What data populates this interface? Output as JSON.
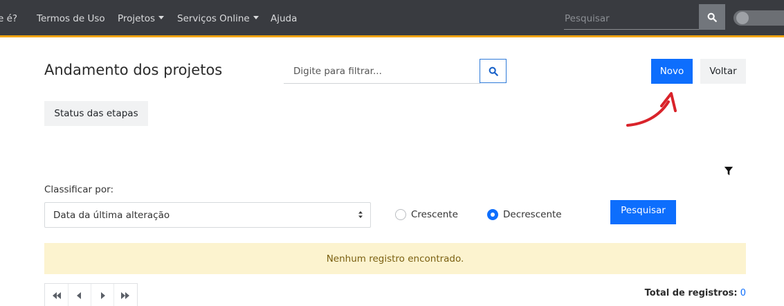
{
  "nav": {
    "items": [
      {
        "label": "e é?"
      },
      {
        "label": "Termos de Uso"
      },
      {
        "label": "Projetos"
      },
      {
        "label": "Serviços Online"
      },
      {
        "label": "Ajuda"
      }
    ],
    "search_placeholder": "Pesquisar"
  },
  "header": {
    "title": "Andamento dos projetos",
    "filter_placeholder": "Digite para filtrar...",
    "new_label": "Novo",
    "back_label": "Voltar"
  },
  "status_button_label": "Status das etapas",
  "sort": {
    "label": "Classificar por:",
    "selected": "Data da última alteração",
    "ascending_label": "Crescente",
    "descending_label": "Decrescente",
    "selected_order": "Decrescente",
    "search_label": "Pesquisar"
  },
  "empty_message": "Nenhum registro encontrado.",
  "footer": {
    "total_label": "Total de registros:",
    "total_value": "0"
  },
  "colors": {
    "nav_bg": "#393b40",
    "nav_accent": "#f0a30a",
    "primary": "#0d6efd",
    "alert_bg": "#fcf3cf",
    "annotation": "#d9232a"
  },
  "icons": [
    "search-icon",
    "filter-icon",
    "sort-updown-icon",
    "first-page-icon",
    "prev-page-icon",
    "next-page-icon",
    "last-page-icon",
    "annotation-arrow"
  ]
}
